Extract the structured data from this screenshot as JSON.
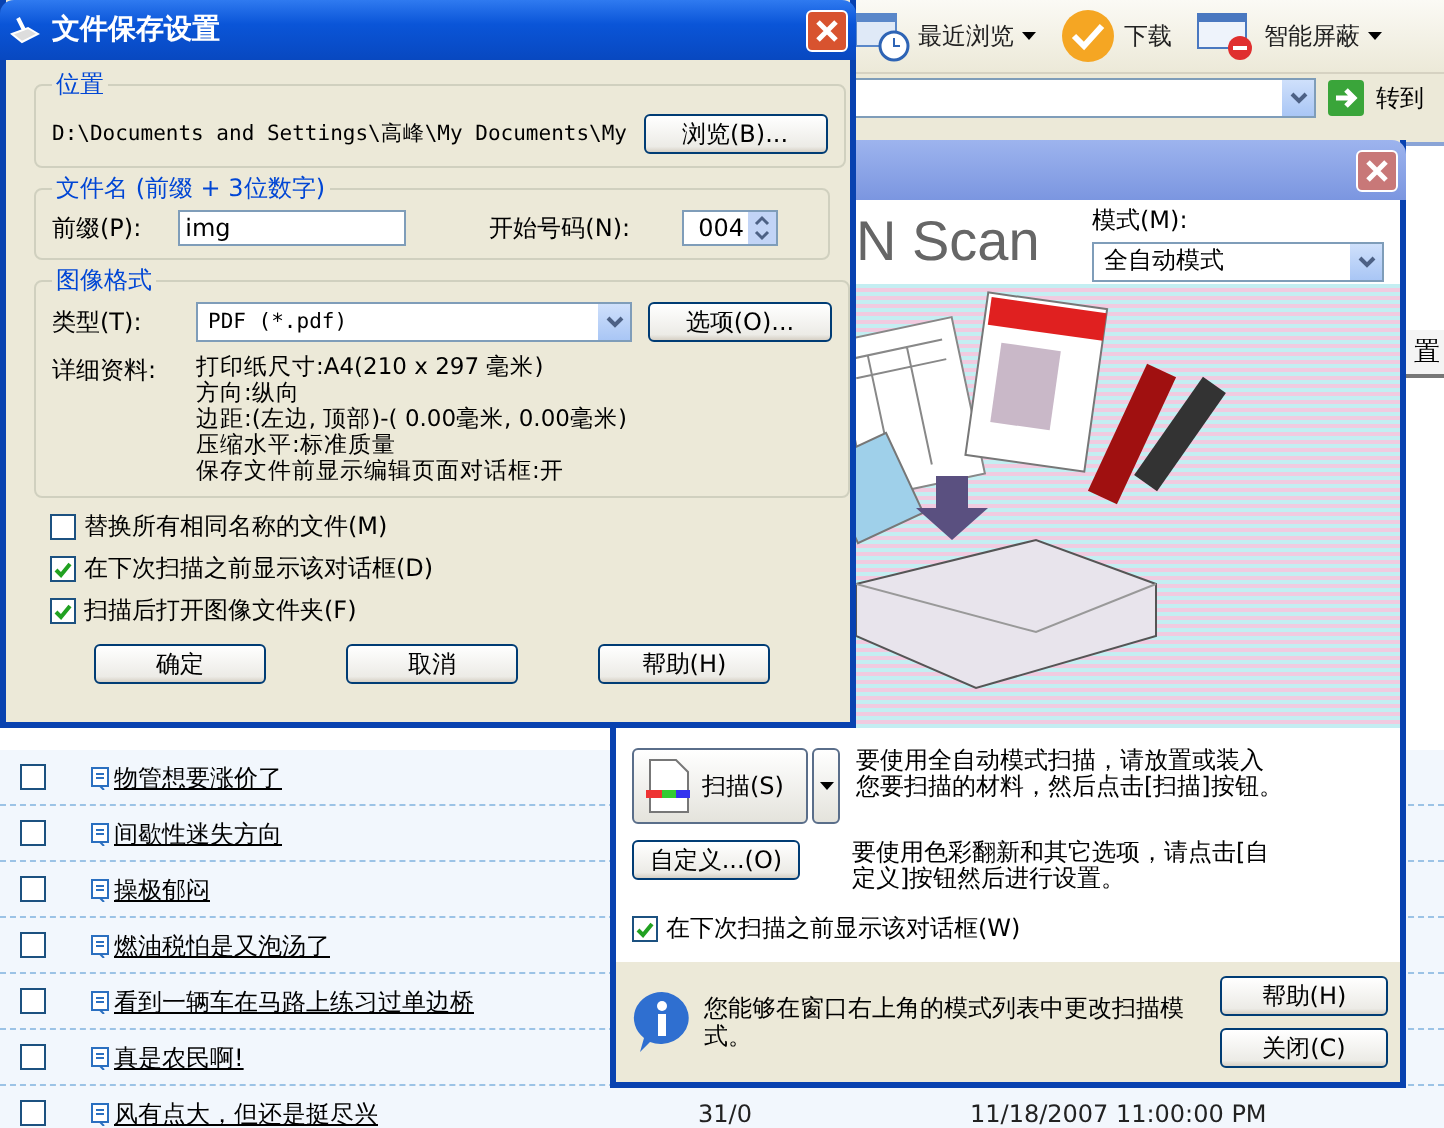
{
  "browser": {
    "toolbar": [
      {
        "kind": "history",
        "label": "最近浏览",
        "dropdown": true
      },
      {
        "kind": "download",
        "label": "下载",
        "dropdown": false
      },
      {
        "kind": "block",
        "label": "智能屏蔽",
        "dropdown": true
      }
    ],
    "go_button": "转到",
    "column_header": "置",
    "posts": [
      {
        "title": "物管想要涨价了",
        "checked": false
      },
      {
        "title": "间歇性迷失方向",
        "checked": false
      },
      {
        "title": "操极郁闷",
        "checked": false
      },
      {
        "title": "燃油税怕是又泡汤了",
        "checked": false
      },
      {
        "title": "看到一辆车在马路上练习过单边桥",
        "checked": false
      },
      {
        "title": "真是农民啊!",
        "checked": false
      },
      {
        "title": "风有点大，但还是挺尽兴",
        "checked": false,
        "column_2": "31/0",
        "column_3": "11/18/2007 11:00:00 PM"
      }
    ]
  },
  "save_dialog": {
    "title": "文件保存设置",
    "location": {
      "legend": "位置",
      "path": "D:\\Documents and Settings\\高峰\\My Documents\\My",
      "browse_button": "浏览(B)..."
    },
    "file_name": {
      "legend": "文件名 (前缀 + 3位数字)",
      "prefix_label": "前缀(P):",
      "prefix_value": "img",
      "start_label": "开始号码(N):",
      "start_value": "004"
    },
    "image_format": {
      "legend": "图像格式",
      "type_label": "类型(T):",
      "type_value": "PDF (*.pdf)",
      "options_button": "选项(O)...",
      "details_label": "详细资料:",
      "details": [
        "打印纸尺寸:A4(210 x 297 毫米)",
        "方向:纵向",
        "边距:(左边, 顶部)-( 0.00毫米, 0.00毫米)",
        "压缩水平:标准质量",
        "保存文件前显示编辑页面对话框:开"
      ]
    },
    "checkboxes": [
      {
        "label": "替换所有相同名称的文件(M)",
        "checked": false
      },
      {
        "label": "在下次扫描之前显示该对话框(D)",
        "checked": true
      },
      {
        "label": "扫描后打开图像文件夹(F)",
        "checked": true
      }
    ],
    "buttons": [
      "确定",
      "取消",
      "帮助(H)"
    ]
  },
  "scan_window": {
    "logo": "N Scan",
    "mode_label": "模式(M):",
    "mode_value": "全自动模式",
    "scan_button": "扫描(S)",
    "scan_text": "要使用全自动模式扫描，请放置或装入您要扫描的材料，然后点击[扫描]按钮。",
    "custom_button": "自定义...(O)",
    "custom_text": "要使用色彩翻新和其它选项，请点击[自定义]按钮然后进行设置。",
    "show_dialog": {
      "label": "在下次扫描之前显示该对话框(W)",
      "checked": true
    },
    "info_text": "您能够在窗口右上角的模式列表中更改扫描模式。",
    "help_button": "帮助(H)",
    "close_button": "关闭(C)"
  }
}
